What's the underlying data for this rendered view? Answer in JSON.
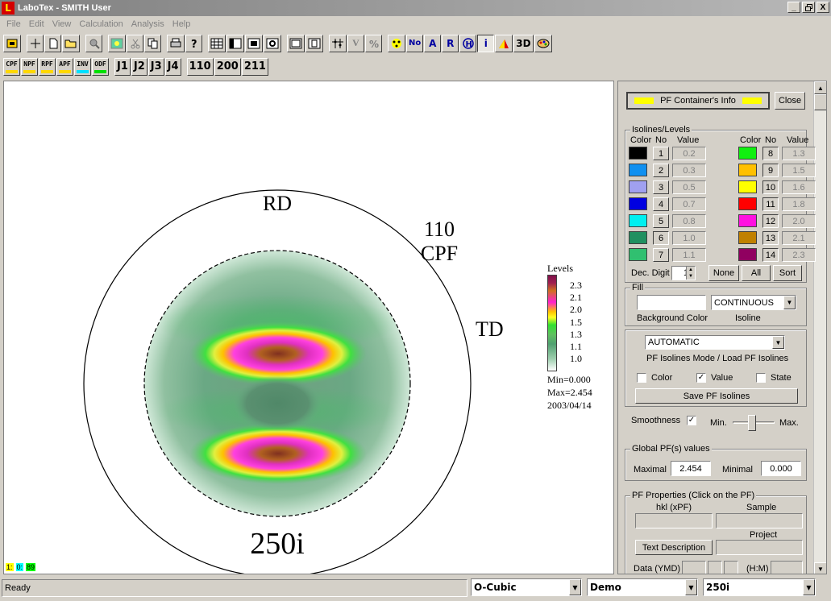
{
  "window": {
    "title": "LaboTex - SMITH User",
    "logo": "L",
    "min_label": "_",
    "restore_label": "8",
    "close_label": "X"
  },
  "menu": [
    "File",
    "Edit",
    "View",
    "Calculation",
    "Analysis",
    "Help"
  ],
  "toolbar2": {
    "pf_types": [
      {
        "label": "CPF",
        "color": "#ffd800"
      },
      {
        "label": "NPF",
        "color": "#ffd800"
      },
      {
        "label": "RPF",
        "color": "#ffd800"
      },
      {
        "label": "APF",
        "color": "#ffd800"
      },
      {
        "label": "INV",
        "color": "#00e0ff"
      },
      {
        "label": "ODF",
        "color": "#00e000"
      }
    ],
    "j_buttons": [
      "J1",
      "J2",
      "J3",
      "J4"
    ],
    "hkl_buttons": [
      "110",
      "200",
      "211"
    ]
  },
  "toolbar1": {
    "no_label": "No",
    "a_label": "A",
    "r_label": "R",
    "i_label": "i",
    "three_d_label": "3D",
    "v_label": "V"
  },
  "plot": {
    "rd_label": "RD",
    "td_label": "TD",
    "hkl": "110",
    "pf_type": "CPF",
    "sample": "250i",
    "legend_title": "Levels",
    "legend_levels": [
      "2.3",
      "2.1",
      "2.0",
      "1.5",
      "1.3",
      "1.1",
      "1.0"
    ],
    "min_text": "Min=0.000",
    "max_text": "Max=2.454",
    "date": "2003/04/14",
    "corner_numbers": [
      "1:",
      "0:",
      "89"
    ]
  },
  "panel": {
    "container_info": "PF Container's Info",
    "close": "Close",
    "isolines_title": "Isolines/Levels",
    "col_color": "Color",
    "col_no": "No",
    "col_value": "Value",
    "levels_left": [
      {
        "no": "1",
        "value": "0.2",
        "color": "#000000"
      },
      {
        "no": "2",
        "value": "0.3",
        "color": "#1090f0"
      },
      {
        "no": "3",
        "value": "0.5",
        "color": "#a0a0f0"
      },
      {
        "no": "4",
        "value": "0.7",
        "color": "#0000e0"
      },
      {
        "no": "5",
        "value": "0.8",
        "color": "#00f0f0"
      },
      {
        "no": "6",
        "value": "1.0",
        "color": "#209060"
      },
      {
        "no": "7",
        "value": "1.1",
        "color": "#30c070"
      }
    ],
    "levels_right": [
      {
        "no": "8",
        "value": "1.3",
        "color": "#10f010"
      },
      {
        "no": "9",
        "value": "1.5",
        "color": "#ffc000"
      },
      {
        "no": "10",
        "value": "1.6",
        "color": "#ffff00"
      },
      {
        "no": "11",
        "value": "1.8",
        "color": "#ff0000"
      },
      {
        "no": "12",
        "value": "2.0",
        "color": "#ff10e0"
      },
      {
        "no": "13",
        "value": "2.1",
        "color": "#c08000"
      },
      {
        "no": "14",
        "value": "2.3",
        "color": "#900060"
      }
    ],
    "dec_digit_label": "Dec. Digit",
    "dec_digit_value": "1",
    "none": "None",
    "all": "All",
    "sort": "Sort",
    "fill_title": "Fill",
    "fill_mode": "CONTINUOUS",
    "background_color_label": "Background Color",
    "isoline_label": "Isoline",
    "isolines_mode": "AUTOMATIC",
    "isolines_mode_label": "PF Isolines Mode / Load PF Isolines",
    "color_cb": "Color",
    "value_cb": "Value",
    "state_cb": "State",
    "check_mark": "✓",
    "save_isolines": "Save PF Isolines",
    "smoothness": "Smoothness",
    "min": "Min.",
    "max": "Max.",
    "global_title": "Global PF(s) values",
    "maximal_label": "Maximal",
    "maximal_value": "2.454",
    "minimal_label": "Minimal",
    "minimal_value": "0.000",
    "props_title": "PF Properties  (Click on the PF)",
    "hkl_label": "hkl  (xPF)",
    "sample_label": "Sample",
    "project_label": "Project",
    "text_description": "Text  Description",
    "data_label": "Data (YMD)",
    "hm_label": "(H:M)"
  },
  "status": {
    "ready": "Ready",
    "symmetry": "O-Cubic",
    "database": "Demo",
    "sample": "250i"
  }
}
